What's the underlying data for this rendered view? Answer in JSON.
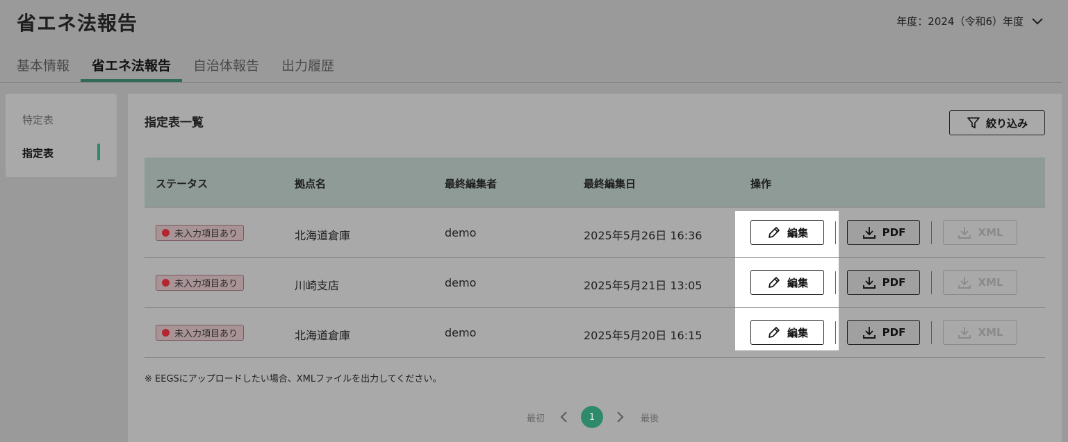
{
  "header": {
    "title": "省エネ法報告",
    "year_label": "年度：2024（令和6）年度"
  },
  "tabs": [
    {
      "label": "基本情報",
      "active": false
    },
    {
      "label": "省エネ法報告",
      "active": true
    },
    {
      "label": "自治体報告",
      "active": false
    },
    {
      "label": "出力履歴",
      "active": false
    }
  ],
  "sidebar": {
    "items": [
      {
        "label": "特定表",
        "active": false
      },
      {
        "label": "指定表",
        "active": true
      }
    ]
  },
  "main": {
    "title": "指定表一覧",
    "filter_label": "絞り込み",
    "columns": [
      "ステータス",
      "拠点名",
      "最終編集者",
      "最終編集日",
      "操作"
    ],
    "rows": [
      {
        "status": "未入力項目あり",
        "site": "北海道倉庫",
        "editor": "demo",
        "date": "2025年5月26日 16:36"
      },
      {
        "status": "未入力項目あり",
        "site": "川崎支店",
        "editor": "demo",
        "date": "2025年5月21日 13:05"
      },
      {
        "status": "未入力項目あり",
        "site": "北海道倉庫",
        "editor": "demo",
        "date": "2025年5月20日 16:15"
      }
    ],
    "actions": {
      "edit": "編集",
      "pdf": "PDF",
      "xml": "XML"
    },
    "note": "※ EEGSにアップロードしたい場合、XMLファイルを出力してください。"
  },
  "pagination": {
    "first": "最初",
    "current": "1",
    "last": "最後"
  },
  "colors": {
    "accent": "#2f8a6b",
    "tab_underline": "#2f6b57",
    "status_dot": "#b3262f"
  },
  "icons": [
    "chevron-down-icon",
    "filter-icon",
    "pencil-icon",
    "download-icon",
    "chevron-left-icon",
    "chevron-right-icon"
  ]
}
